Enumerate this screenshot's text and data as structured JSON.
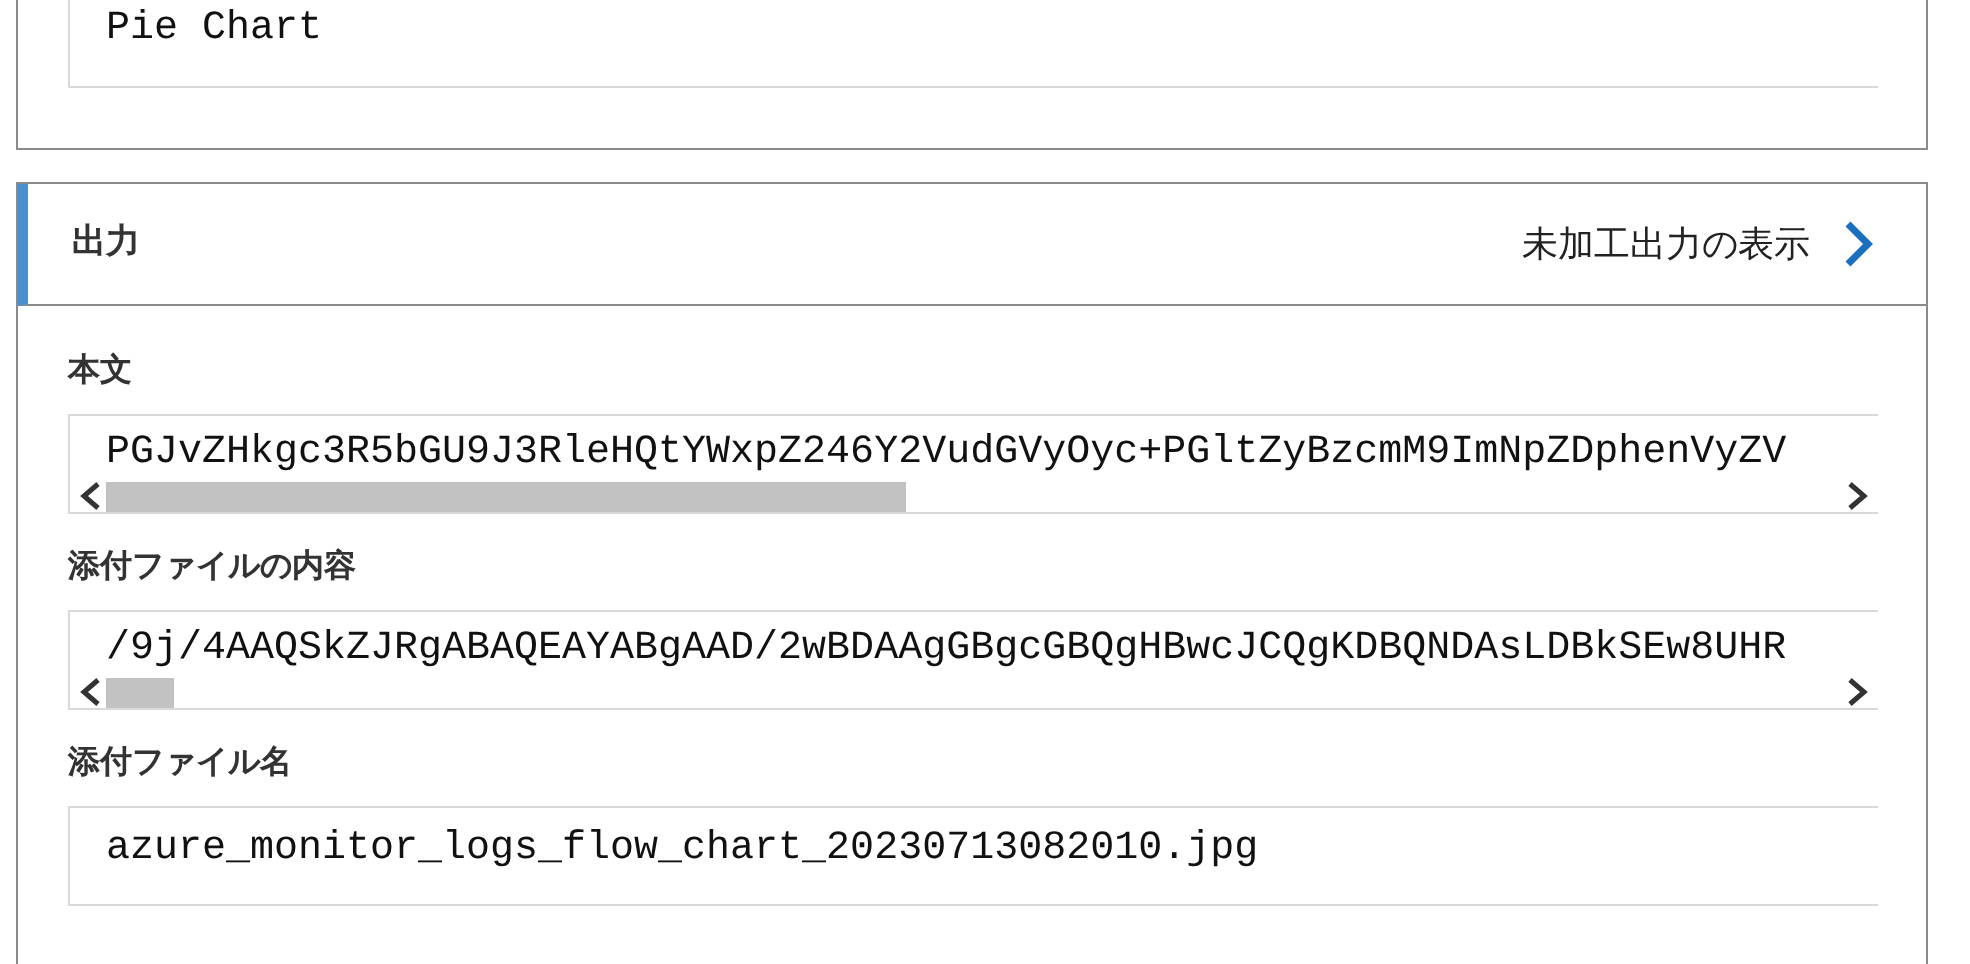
{
  "previous_field": {
    "value": "Pie Chart"
  },
  "output_panel": {
    "title": "出力",
    "raw_output_link": "未加工出力の表示",
    "fields": [
      {
        "label": "本文",
        "value": "PGJvZHkgc3R5bGU9J3RleHQtYWxpZ246Y2VudGVyOyc+PGltZyBzcmM9ImNpZDphenVyZV",
        "kind": "scroll"
      },
      {
        "label": "添付ファイルの内容",
        "value": "/9j/4AAQSkZJRgABAQEAYABgAAD/2wBDAAgGBgcGBQgHBwcJCQgKDBQNDAsLDBkSEw8UHR",
        "kind": "scroll"
      },
      {
        "label": "添付ファイル名",
        "value": "azure_monitor_logs_flow_chart_20230713082010.jpg",
        "kind": "plain"
      }
    ]
  }
}
